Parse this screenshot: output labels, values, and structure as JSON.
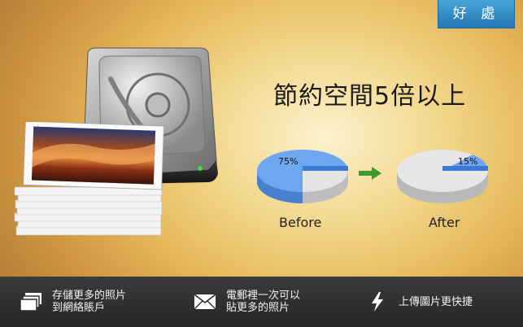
{
  "badge": {
    "label": "好 處"
  },
  "headline": {
    "text": "節約空間5倍以上"
  },
  "pies": {
    "before": {
      "label": "Before",
      "percent_text": "75%",
      "value": 0.75
    },
    "after": {
      "label": "After",
      "percent_text": "15%",
      "value": 0.15
    },
    "colors": {
      "highlight": "#6ea6f0",
      "rest": "#e4e4e4",
      "arrow": "#3c9a2a"
    }
  },
  "features": [
    {
      "icon": "photos-stack-icon",
      "line1": "存儲更多的照片",
      "line2": "到網絡賬戶"
    },
    {
      "icon": "envelope-icon",
      "line1": "電郵裡一次可以",
      "line2": "貼更多的照片"
    },
    {
      "icon": "lightning-icon",
      "line1": "上傳圖片更快捷",
      "line2": ""
    }
  ]
}
